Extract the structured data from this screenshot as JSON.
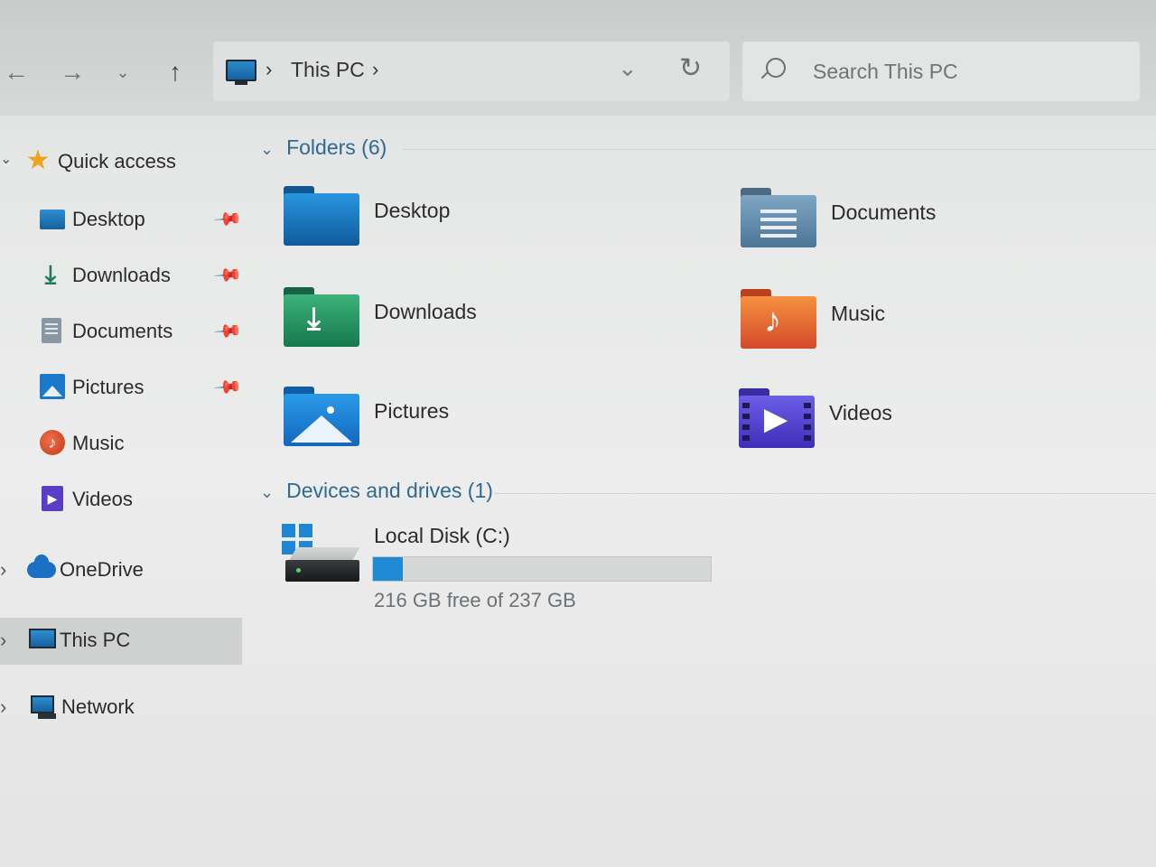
{
  "window": {
    "title": "This PC"
  },
  "navigation": {
    "back_icon": "arrow-left-icon",
    "forward_icon": "arrow-right-icon",
    "recent_icon": "chevron-down-icon",
    "up_icon": "arrow-up-icon"
  },
  "address_bar": {
    "icon": "computer-icon",
    "path": [
      "This PC"
    ],
    "separator": "›"
  },
  "search": {
    "placeholder": "Search This PC"
  },
  "sidebar": {
    "items": [
      {
        "label": "Quick access",
        "icon": "star-icon",
        "expanded": true
      },
      {
        "label": "Desktop",
        "icon": "desktop-icon",
        "pinned": true
      },
      {
        "label": "Downloads",
        "icon": "download-icon",
        "pinned": true
      },
      {
        "label": "Documents",
        "icon": "documents-icon",
        "pinned": true
      },
      {
        "label": "Pictures",
        "icon": "pictures-icon",
        "pinned": true
      },
      {
        "label": "Music",
        "icon": "music-icon"
      },
      {
        "label": "Videos",
        "icon": "videos-icon"
      },
      {
        "label": "OneDrive",
        "icon": "onedrive-icon",
        "expandable": true
      },
      {
        "label": "This PC",
        "icon": "computer-icon",
        "expandable": true,
        "selected": true
      },
      {
        "label": "Network",
        "icon": "network-icon",
        "expandable": true
      }
    ]
  },
  "main": {
    "folders_header": "Folders (6)",
    "folders": [
      {
        "label": "Desktop",
        "icon": "desktop-folder-icon"
      },
      {
        "label": "Documents",
        "icon": "documents-folder-icon"
      },
      {
        "label": "Downloads",
        "icon": "downloads-folder-icon"
      },
      {
        "label": "Music",
        "icon": "music-folder-icon"
      },
      {
        "label": "Pictures",
        "icon": "pictures-folder-icon"
      },
      {
        "label": "Videos",
        "icon": "videos-folder-icon"
      }
    ],
    "drives_header": "Devices and drives (1)",
    "drives": [
      {
        "label": "Local Disk (C:)",
        "free_text": "216 GB free of 237 GB",
        "used_fraction": 0.089,
        "icon": "hard-drive-icon"
      }
    ]
  },
  "colors": {
    "accent": "#1f8ad6",
    "section_header": "#2f6a93",
    "selected_bg": "#cfd1d0"
  }
}
